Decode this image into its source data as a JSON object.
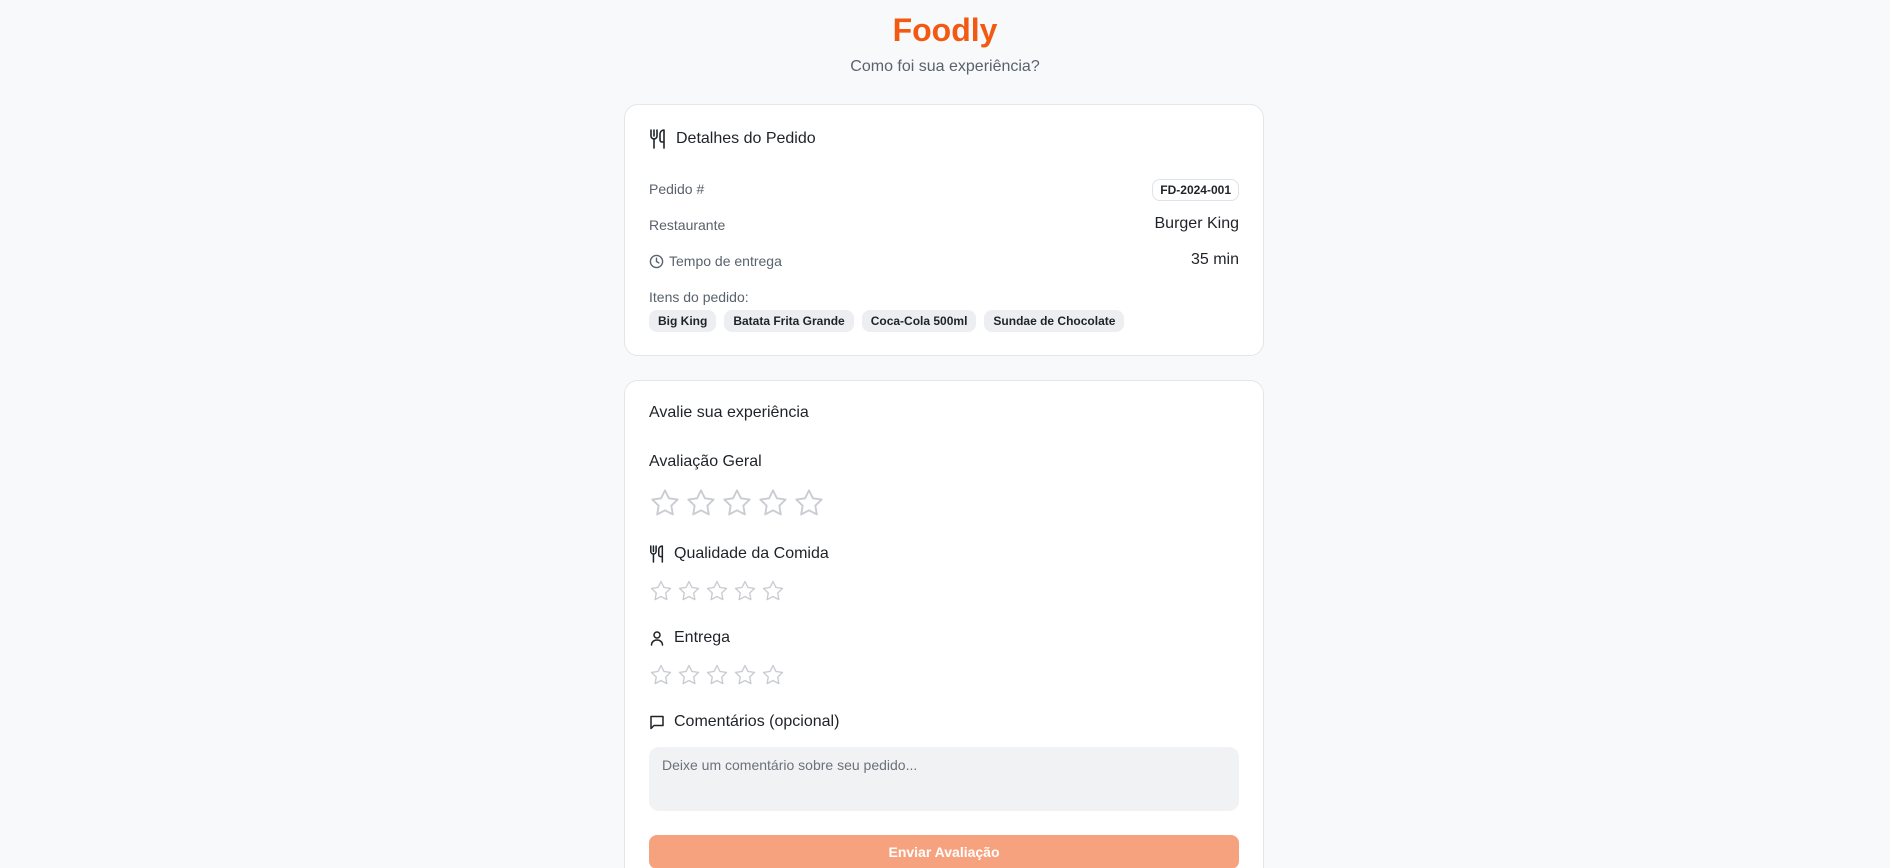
{
  "app": {
    "brand": "Foodly",
    "subtitle": "Como foi sua experiência?",
    "accent_color": "#f25a14"
  },
  "order": {
    "title": "Detalhes do Pedido",
    "title_icon": "utensils-icon",
    "order_label": "Pedido #",
    "order_id": "FD-2024-001",
    "restaurant_label": "Restaurante",
    "restaurant": "Burger King",
    "delivery_time_label": "Tempo de entrega",
    "delivery_time_icon": "clock-icon",
    "delivery_time": "35 min",
    "items_label": "Itens do pedido:",
    "items": [
      "Big King",
      "Batata Frita Grande",
      "Coca-Cola 500ml",
      "Sundae de Chocolate"
    ]
  },
  "review": {
    "title": "Avalie sua experiência",
    "overall": {
      "label": "Avaliação Geral",
      "rating": 0,
      "max": 5
    },
    "food_quality": {
      "label": "Qualidade da Comida",
      "icon": "utensils-icon",
      "rating": 0,
      "max": 5
    },
    "delivery": {
      "label": "Entrega",
      "icon": "user-icon",
      "rating": 0,
      "max": 5
    },
    "comments": {
      "label": "Comentários (opcional)",
      "icon": "message-square-icon",
      "value": "",
      "placeholder": "Deixe um comentário sobre seu pedido..."
    },
    "submit_label": "Enviar Avaliação"
  }
}
